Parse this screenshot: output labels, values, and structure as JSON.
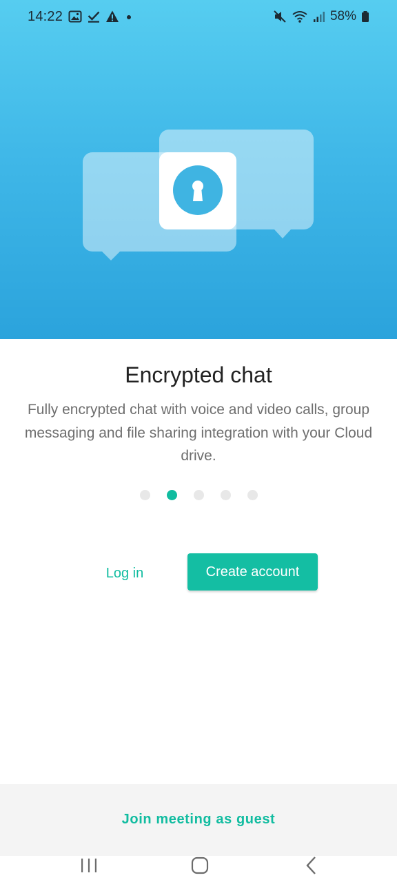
{
  "status_bar": {
    "time": "14:22",
    "battery": "58%",
    "left_icons": [
      "image-icon",
      "check-icon",
      "warning-icon",
      "dot-icon"
    ],
    "right_icons": [
      "mute-icon",
      "wifi-icon",
      "signal-icon",
      "battery-icon"
    ]
  },
  "hero": {
    "illustration": "encrypted-chat-bubbles-with-lock"
  },
  "onboarding": {
    "title": "Encrypted chat",
    "description": "Fully encrypted chat with voice and video calls, group messaging and file sharing integration with your Cloud drive.",
    "page_indicator": {
      "total": 5,
      "active_index": 1
    }
  },
  "actions": {
    "login_label": "Log in",
    "create_account_label": "Create account"
  },
  "footer": {
    "guest_label": "Join meeting as guest"
  },
  "nav_bar": {
    "buttons": [
      "recent-apps-icon",
      "home-icon",
      "back-icon"
    ]
  },
  "colors": {
    "accent": "#14bea3",
    "hero_top": "#56cdf0",
    "hero_bottom": "#2ba3dc",
    "text_primary": "#222222",
    "text_secondary": "#6e6e6e"
  }
}
